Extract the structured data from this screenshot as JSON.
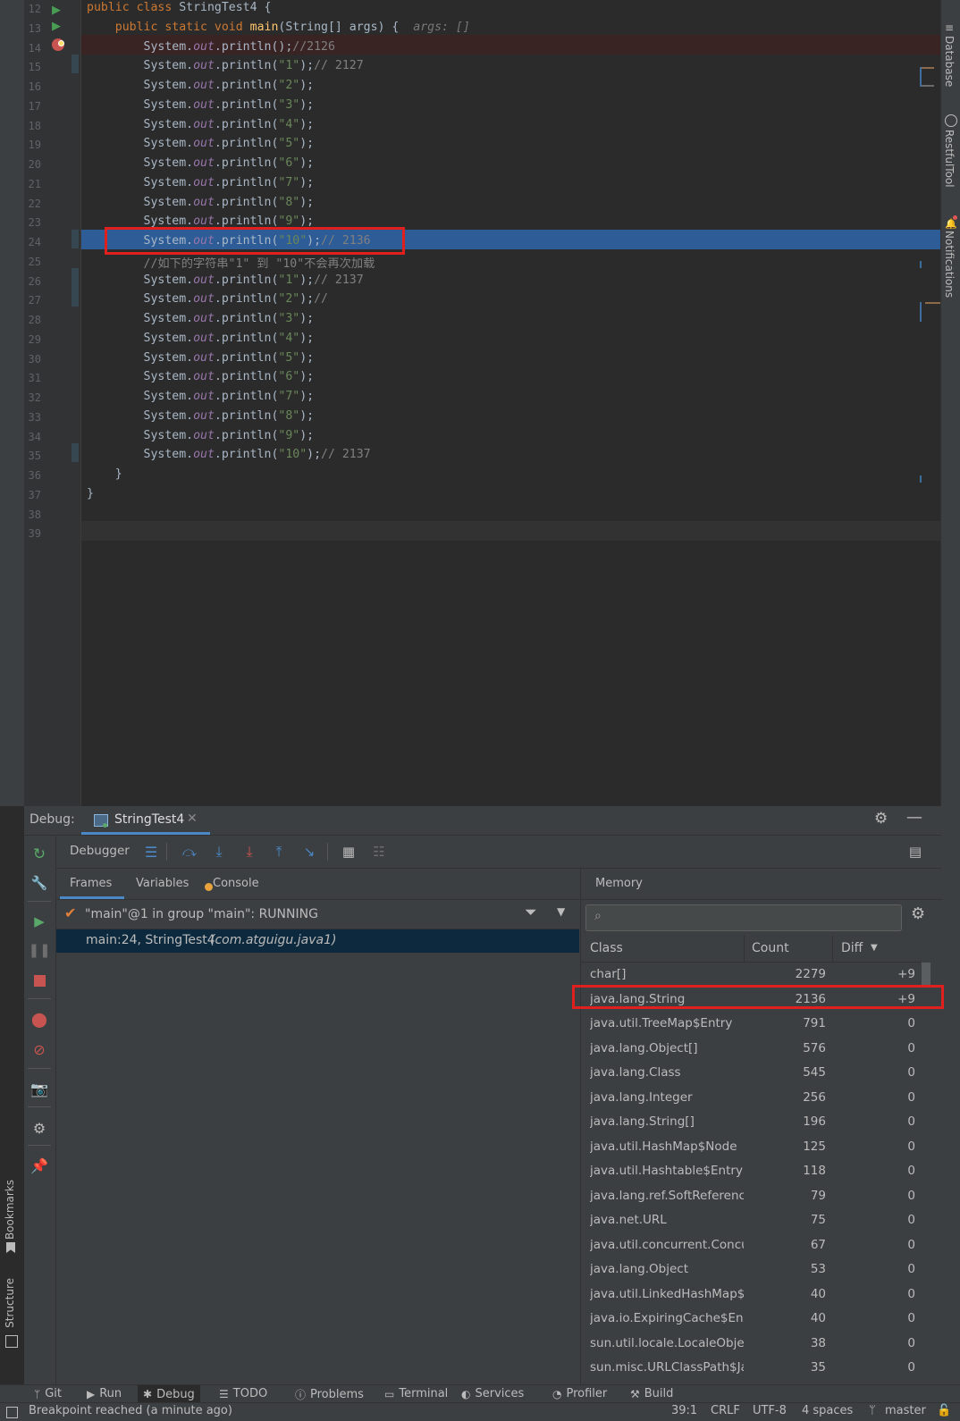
{
  "editor": {
    "lines": [
      {
        "num": "12",
        "html": "<span class='kw'>public class </span>StringTest4 {"
      },
      {
        "num": "13",
        "html": "    <span class='kw'>public static void </span><span class='fn'>main</span>(String[] args) {  <span class='hint'>args: []</span>"
      },
      {
        "num": "14",
        "html": "        System.<span class='fld'>out</span>.println();<span class='cmt'>//2126</span>"
      },
      {
        "num": "15",
        "html": "        System.<span class='fld'>out</span>.println(<span class='str'>\"1\"</span>);<span class='cmt'>// 2127</span>"
      },
      {
        "num": "16",
        "html": "        System.<span class='fld'>out</span>.println(<span class='str'>\"2\"</span>);"
      },
      {
        "num": "17",
        "html": "        System.<span class='fld'>out</span>.println(<span class='str'>\"3\"</span>);"
      },
      {
        "num": "18",
        "html": "        System.<span class='fld'>out</span>.println(<span class='str'>\"4\"</span>);"
      },
      {
        "num": "19",
        "html": "        System.<span class='fld'>out</span>.println(<span class='str'>\"5\"</span>);"
      },
      {
        "num": "20",
        "html": "        System.<span class='fld'>out</span>.println(<span class='str'>\"6\"</span>);"
      },
      {
        "num": "21",
        "html": "        System.<span class='fld'>out</span>.println(<span class='str'>\"7\"</span>);"
      },
      {
        "num": "22",
        "html": "        System.<span class='fld'>out</span>.println(<span class='str'>\"8\"</span>);"
      },
      {
        "num": "23",
        "html": "        System.<span class='fld'>out</span>.println(<span class='str'>\"9\"</span>);"
      },
      {
        "num": "24",
        "html": "        System.<span class='fld'>out</span>.println(<span class='str'>\"10\"</span>);<span class='cmt'>// 2136</span>"
      },
      {
        "num": "25",
        "html": "        <span class='cmt'>//如下的字符串\"1\" 到 \"10\"不会再次加载</span>"
      },
      {
        "num": "26",
        "html": "        System.<span class='fld'>out</span>.println(<span class='str'>\"1\"</span>);<span class='cmt'>// 2137</span>"
      },
      {
        "num": "27",
        "html": "        System.<span class='fld'>out</span>.println(<span class='str'>\"2\"</span>);<span class='cmt'>//</span>"
      },
      {
        "num": "28",
        "html": "        System.<span class='fld'>out</span>.println(<span class='str'>\"3\"</span>);"
      },
      {
        "num": "29",
        "html": "        System.<span class='fld'>out</span>.println(<span class='str'>\"4\"</span>);"
      },
      {
        "num": "30",
        "html": "        System.<span class='fld'>out</span>.println(<span class='str'>\"5\"</span>);"
      },
      {
        "num": "31",
        "html": "        System.<span class='fld'>out</span>.println(<span class='str'>\"6\"</span>);"
      },
      {
        "num": "32",
        "html": "        System.<span class='fld'>out</span>.println(<span class='str'>\"7\"</span>);"
      },
      {
        "num": "33",
        "html": "        System.<span class='fld'>out</span>.println(<span class='str'>\"8\"</span>);"
      },
      {
        "num": "34",
        "html": "        System.<span class='fld'>out</span>.println(<span class='str'>\"9\"</span>);"
      },
      {
        "num": "35",
        "html": "        System.<span class='fld'>out</span>.println(<span class='str'>\"10\"</span>);<span class='cmt'>// 2137</span>"
      },
      {
        "num": "36",
        "html": "    }"
      },
      {
        "num": "37",
        "html": "}"
      },
      {
        "num": "38",
        "html": ""
      },
      {
        "num": "39",
        "html": ""
      }
    ]
  },
  "right_sidebar": {
    "database": "Database",
    "restful": "RestfulTool",
    "notifications": "Notifications"
  },
  "left_sidebar": {
    "bookmarks": "Bookmarks",
    "structure": "Structure"
  },
  "debug": {
    "label": "Debug:",
    "session_tab": "StringTest4",
    "toolbar_debugger": "Debugger",
    "tabs": {
      "frames": "Frames",
      "variables": "Variables",
      "console": "Console"
    },
    "thread": "\"main\"@1 in group \"main\": RUNNING",
    "frame_main": "main:24, StringTest4",
    "frame_pkg": "(com.atguigu.java1)",
    "memory": {
      "title": "Memory",
      "columns": {
        "class": "Class",
        "count": "Count",
        "diff": "Diff"
      },
      "rows": [
        {
          "cls": "char[]",
          "count": "2279",
          "diff": "+9"
        },
        {
          "cls": "java.lang.String",
          "count": "2136",
          "diff": "+9"
        },
        {
          "cls": "java.util.TreeMap$Entry",
          "count": "791",
          "diff": "0"
        },
        {
          "cls": "java.lang.Object[]",
          "count": "576",
          "diff": "0"
        },
        {
          "cls": "java.lang.Class",
          "count": "545",
          "diff": "0"
        },
        {
          "cls": "java.lang.Integer",
          "count": "256",
          "diff": "0"
        },
        {
          "cls": "java.lang.String[]",
          "count": "196",
          "diff": "0"
        },
        {
          "cls": "java.util.HashMap$Node",
          "count": "125",
          "diff": "0"
        },
        {
          "cls": "java.util.Hashtable$Entry",
          "count": "118",
          "diff": "0"
        },
        {
          "cls": "java.lang.ref.SoftReference",
          "count": "79",
          "diff": "0"
        },
        {
          "cls": "java.net.URL",
          "count": "75",
          "diff": "0"
        },
        {
          "cls": "java.util.concurrent.Concu",
          "count": "67",
          "diff": "0"
        },
        {
          "cls": "java.lang.Object",
          "count": "53",
          "diff": "0"
        },
        {
          "cls": "java.util.LinkedHashMap$",
          "count": "40",
          "diff": "0"
        },
        {
          "cls": "java.io.ExpiringCache$Entr",
          "count": "40",
          "diff": "0"
        },
        {
          "cls": "sun.util.locale.LocaleObjec",
          "count": "38",
          "diff": "0"
        },
        {
          "cls": "sun.misc.URLClassPath$Ja",
          "count": "35",
          "diff": "0"
        }
      ]
    }
  },
  "bottom_tabs": [
    "Git",
    "Run",
    "Debug",
    "TODO",
    "Problems",
    "Terminal",
    "Services",
    "Profiler",
    "Build"
  ],
  "status": {
    "message": "Breakpoint reached (a minute ago)",
    "position": "39:1",
    "line_sep": "CRLF",
    "encoding": "UTF-8",
    "indent": "4 spaces",
    "branch": "master"
  }
}
